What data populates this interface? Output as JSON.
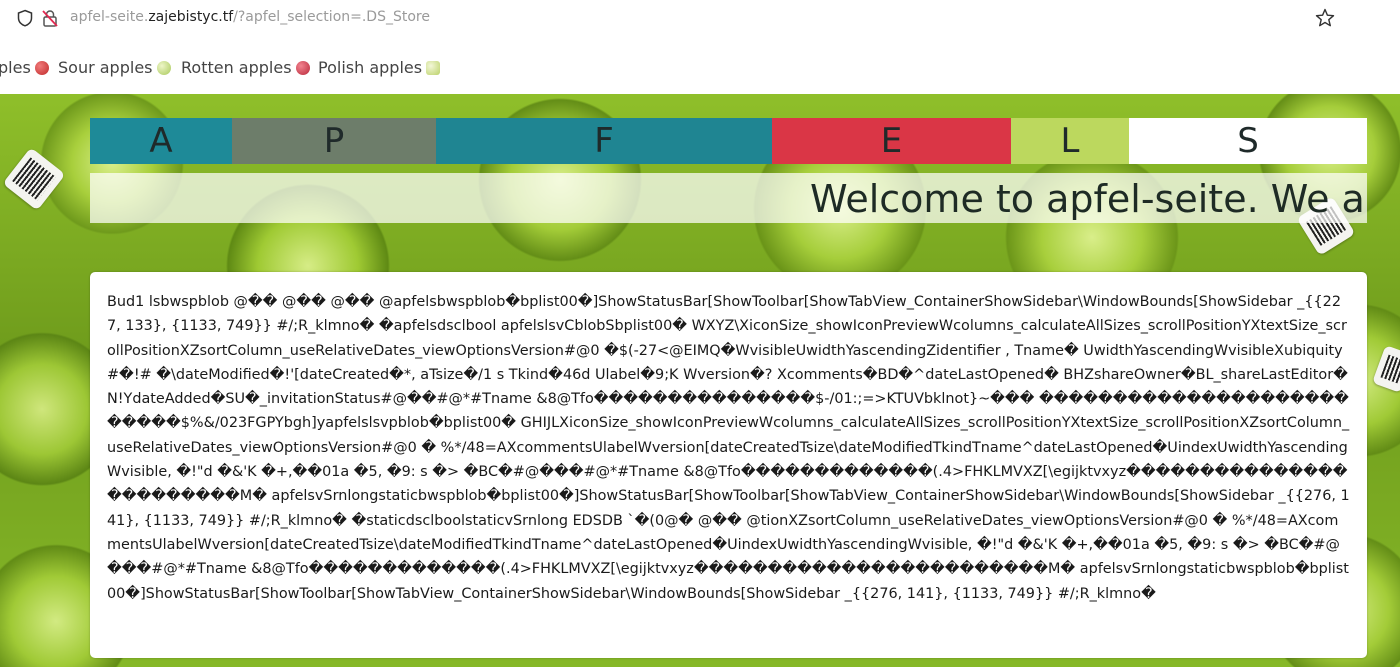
{
  "browser": {
    "url_scheme_prefix": "apfel-seite.",
    "url_host": "zajebistyc.tf",
    "url_path": "/?apfel_selection=.DS_Store",
    "icons": [
      "shield-icon",
      "insecure-lock-icon",
      "bookmark-star-icon"
    ]
  },
  "bookmarks": {
    "items": [
      {
        "label": "ples",
        "apple_color": "#d64040"
      },
      {
        "label": "Sour apples",
        "apple_color": "#b9d86a"
      },
      {
        "label": "Rotten apples",
        "apple_color": "#c8354a"
      },
      {
        "label": "Polish apples",
        "apple_color": "#c9dc7a"
      }
    ]
  },
  "banner": {
    "letters": [
      {
        "char": "A",
        "color": "#1e8a98"
      },
      {
        "char": "P",
        "color": "#6d7d6a"
      },
      {
        "char": "F",
        "color": "#1f8592"
      },
      {
        "char": "E",
        "color": "#da3646"
      },
      {
        "char": "L",
        "color": "#bcd85e"
      },
      {
        "char": "S",
        "color": "#ffffff"
      }
    ]
  },
  "welcome": {
    "text": "Welcome to apfel-seite. We a"
  },
  "content": {
    "text": "Bud1  lsbwspblob @�� @�� @�� @apfelsbwspblob�bplist00�]ShowStatusBar[ShowToolbar[ShowTabView_ContainerShowSidebar\\WindowBounds[ShowSidebar _{{227, 133}, {1133, 749}} #/;R_klmno� �apfelsdsclbool apfelslsvCblobSbplist00�  WXYZ\\XiconSize_showIconPreviewWcolumns_calculateAllSizes_scrollPositionYXtextSize_scrollPositionXZsortColumn_useRelativeDates_viewOptionsVersion#@0 �$(-27<@EIMQ�WvisibleUwidthYascendingZidentifier , Tname� UwidthYascendingWvisibleXubiquity#�!# �\\dateModified�!'[dateCreated�*, aTsize�/1 s Tkind�46d Ulabel�9;K Wversion�? Xcomments�BD�^dateLastOpened� BHZshareOwner�BL_shareLastEditor�N!YdateAdded�SU�_invitationStatus#@��#@*#Tname &8@Tfo���������������$-/01:;=>KTUVbklnot}~��� ��������������������������$%&/023FGPYbgh]yapfelslsvpblob�bplist00�  GHIJLXiconSize_showIconPreviewWcolumns_calculateAllSizes_scrollPositionYXtextSize_scrollPositionXZsortColumn_useRelativeDates_viewOptionsVersion#@0 � %*/48=AXcommentsUlabelWversion[dateCreatedTsize\\dateModifiedTkindTname^dateLastOpened�UindexUwidthYascendingWvisible, �!\"d �&'K �+,��01a �5, �9: s �> �BC�#@���#@*#Tname &8@Tfo�������������(.4>FHKLMVXZ[\\egijktvxyz������������������������M� apfelsvSrnlongstaticbwspblob�bplist00�]ShowStatusBar[ShowToolbar[ShowTabView_ContainerShowSidebar\\WindowBounds[ShowSidebar _{{276, 141}, {1133, 749}} #/;R_klmno� �staticdsclboolstaticvSrnlong EDSDB `�(0@� @�� @tionXZsortColumn_useRelativeDates_viewOptionsVersion#@0 � %*/48=AXcommentsUlabelWversion[dateCreatedTsize\\dateModifiedTkindTname^dateLastOpened�UindexUwidthYascendingWvisible, �!\"d �&'K �+,��01a �5, �9: s �> �BC�#@���#@*#Tname &8@Tfo�������������(.4>FHKLMVXZ[\\egijktvxyz������������������������M� apfelsvSrnlongstaticbwspblob�bplist00�]ShowStatusBar[ShowToolbar[ShowTabView_ContainerShowSidebar\\WindowBounds[ShowSidebar _{{276, 141}, {1133, 749}} #/;R_klmno�"
  }
}
